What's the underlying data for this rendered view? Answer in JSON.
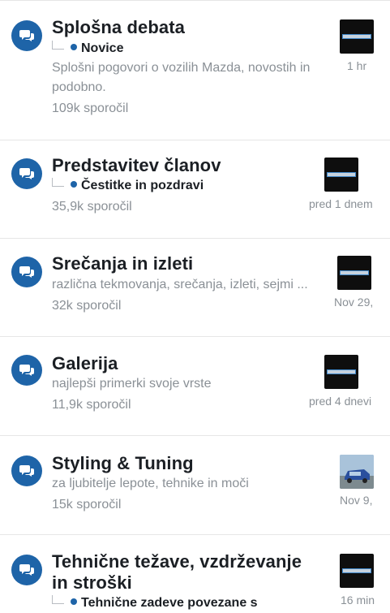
{
  "forums": [
    {
      "title": "Splošna debata",
      "subforum": "Novice",
      "description": "Splošni pogovori o vozilih Mazda, novostih in podobno.",
      "count": "109k sporočil",
      "time": "1 hr",
      "avatar": "skyactiv-thumb"
    },
    {
      "title": "Predstavitev članov",
      "subforum": "Čestitke in pozdravi",
      "count": "35,9k sporočil",
      "time": "pred 1 dnem",
      "avatar": "skyactiv-thumb"
    },
    {
      "title": "Srečanja in izleti",
      "description": "različna tekmovanja, srečanja, izleti, sejmi ...",
      "count": "32k sporočil",
      "time": "Nov 29,",
      "avatar": "skyactiv-thumb"
    },
    {
      "title": "Galerija",
      "description": "najlepši primerki svoje vrste",
      "count": "11,9k sporočil",
      "time": "pred 4 dnevi",
      "avatar": "skyactiv-thumb"
    },
    {
      "title": "Styling & Tuning",
      "description": "za ljubitelje lepote, tehnike in moči",
      "count": "15k sporočil",
      "time": "Nov 9,",
      "avatar": "car-photo-thumb"
    },
    {
      "title_line1": "Tehnične težave, vzdrževanje",
      "title_line2": "in stroški",
      "subforum": "Tehnične zadeve povezane s",
      "time": "16 min",
      "avatar": "skyactiv-thumb"
    }
  ],
  "icons": {
    "forum": "chat-bubbles-icon"
  },
  "colors": {
    "accent": "#1e64a8",
    "muted": "#8a9096"
  }
}
